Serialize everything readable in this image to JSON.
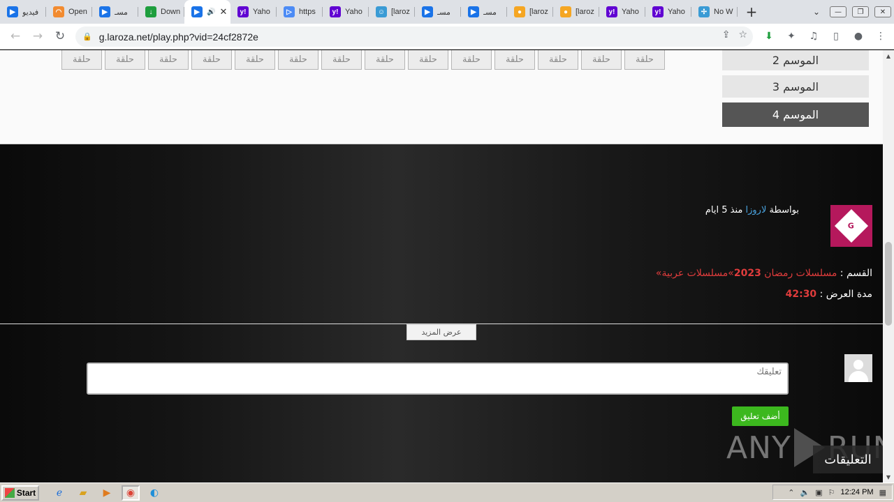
{
  "browser": {
    "tabs": [
      {
        "title": "فيديو",
        "color": "#1a73e8",
        "glyph": "▶"
      },
      {
        "title": "Open",
        "color": "#f28b30",
        "glyph": "◠"
      },
      {
        "title": "مسـ",
        "color": "#1a73e8",
        "glyph": "▶"
      },
      {
        "title": "Down",
        "color": "#1e9e3e",
        "glyph": "↓"
      },
      {
        "title": "",
        "color": "#1a73e8",
        "glyph": "▶",
        "active": true
      },
      {
        "title": "Yaho",
        "color": "#6001d2",
        "glyph": "y!"
      },
      {
        "title": "https",
        "color": "#4c8bf5",
        "glyph": "▷"
      },
      {
        "title": "Yaho",
        "color": "#6001d2",
        "glyph": "y!"
      },
      {
        "title": "[laroz",
        "color": "#3a9bd5",
        "glyph": "☺"
      },
      {
        "title": "مسـ",
        "color": "#1a73e8",
        "glyph": "▶"
      },
      {
        "title": "مسـ",
        "color": "#1a73e8",
        "glyph": "▶"
      },
      {
        "title": "[laroz",
        "color": "#f5a623",
        "glyph": "●"
      },
      {
        "title": "[laroz",
        "color": "#f5a623",
        "glyph": "●"
      },
      {
        "title": "Yaho",
        "color": "#6001d2",
        "glyph": "y!"
      },
      {
        "title": "Yaho",
        "color": "#6001d2",
        "glyph": "y!"
      },
      {
        "title": "No W",
        "color": "#3a9bd5",
        "glyph": "✢"
      }
    ],
    "url": "g.laroza.net/play.php?vid=24cf2872e"
  },
  "episodes": {
    "label": "حلقة",
    "count": 14
  },
  "seasons": [
    {
      "label": "الموسم 2",
      "active": false
    },
    {
      "label": "الموسم 3",
      "active": false
    },
    {
      "label": "الموسم 4",
      "active": true
    }
  ],
  "author": {
    "by": "بواسطة",
    "name": "لاروزا",
    "since": "منذ 5 ايام",
    "logo_text": "G"
  },
  "meta": {
    "category_label": "القسم :",
    "category_a": "مسلسلات رمضان ",
    "category_year": "2023",
    "category_b": "»مسلسلات عربية»",
    "duration_label": "مدة العرض :",
    "duration_value": "42:30"
  },
  "show_more": "عرض المزيد",
  "comments": {
    "placeholder": "تعليقك",
    "submit": "أضف تعليق",
    "heading": "التعليقات"
  },
  "watermark": {
    "left": "ANY",
    "right": "RUN"
  },
  "taskbar": {
    "start": "Start",
    "time": "12:24 PM"
  }
}
